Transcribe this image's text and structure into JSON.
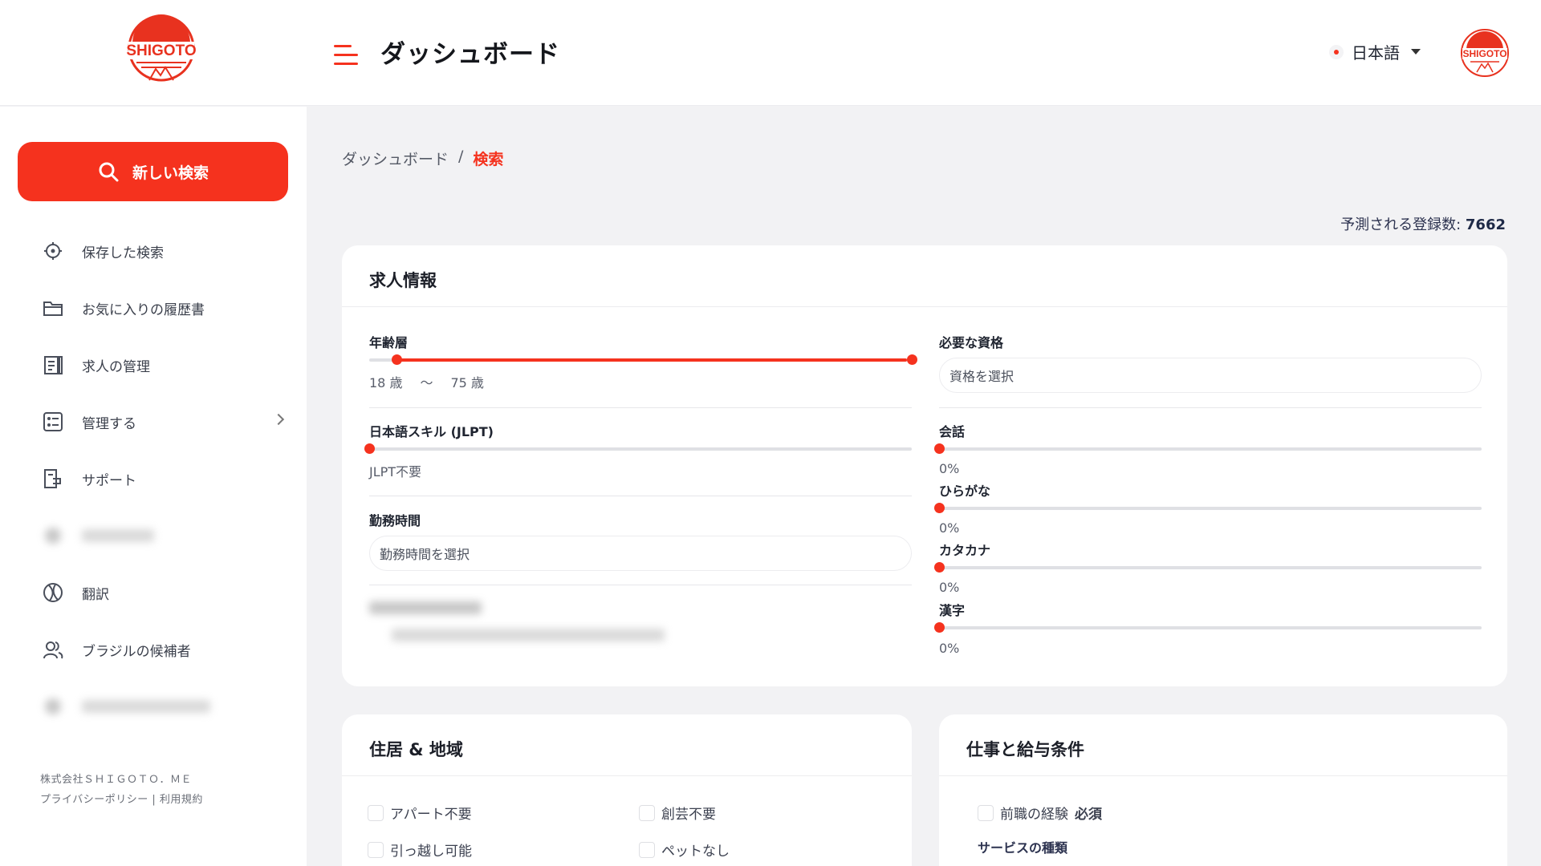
{
  "header": {
    "logo_text": "SHIGOTO",
    "title": "ダッシュボード",
    "language": "日本語",
    "avatar_text": "SHIGOTO"
  },
  "sidebar": {
    "new_search_label": "新しい検索",
    "items": [
      {
        "label": "保存した検索",
        "icon": "crosshair-icon"
      },
      {
        "label": "お気に入りの履歴書",
        "icon": "folder-icon"
      },
      {
        "label": "求人の管理",
        "icon": "clipboard-icon"
      },
      {
        "label": "管理する",
        "icon": "settings-list-icon"
      },
      {
        "label": "サポート",
        "icon": "support-icon"
      },
      {
        "label": "翻訳",
        "icon": "translate-icon"
      },
      {
        "label": "ブラジルの候補者",
        "icon": "users-icon"
      }
    ],
    "footer_company": "株式会社ＳＨＩＧＯＴＯ．ＭＥ",
    "footer_links": "プライバシーポリシー | 利用規約"
  },
  "breadcrumb": {
    "root": "ダッシュボード",
    "separator": "/",
    "current": "検索"
  },
  "predicted": {
    "label": "予測される登録数:",
    "value": "7662"
  },
  "job_info": {
    "title": "求人情報",
    "age": {
      "label": "年齢層",
      "min": "18 歳",
      "separator": "〜",
      "max": "75 歳",
      "range_min": 18,
      "range_max": 75,
      "value_min": 18,
      "value_max": 75
    },
    "qualifications": {
      "label": "必要な資格",
      "placeholder": "資格を選択"
    },
    "jlpt": {
      "label": "日本語スキル (JLPT)",
      "value_text": "JLPT不要",
      "level": 0
    },
    "conversation": {
      "label": "会話",
      "value": "0%"
    },
    "hiragana": {
      "label": "ひらがな",
      "value": "0%"
    },
    "katakana": {
      "label": "カタカナ",
      "value": "0%"
    },
    "kanji": {
      "label": "漢字",
      "value": "0%"
    },
    "work_hours": {
      "label": "勤務時間",
      "placeholder": "勤務時間を選択"
    }
  },
  "housing": {
    "title": "住居 & 地域",
    "options": [
      "アパート不要",
      "創芸不要",
      "引っ越し可能",
      "ペットなし"
    ]
  },
  "work_conditions": {
    "title": "仕事と給与条件",
    "experience_prefix": "前職の経験",
    "experience_required": "必須",
    "service_type_label": "サービスの種類"
  },
  "colors": {
    "accent": "#f5321e"
  }
}
